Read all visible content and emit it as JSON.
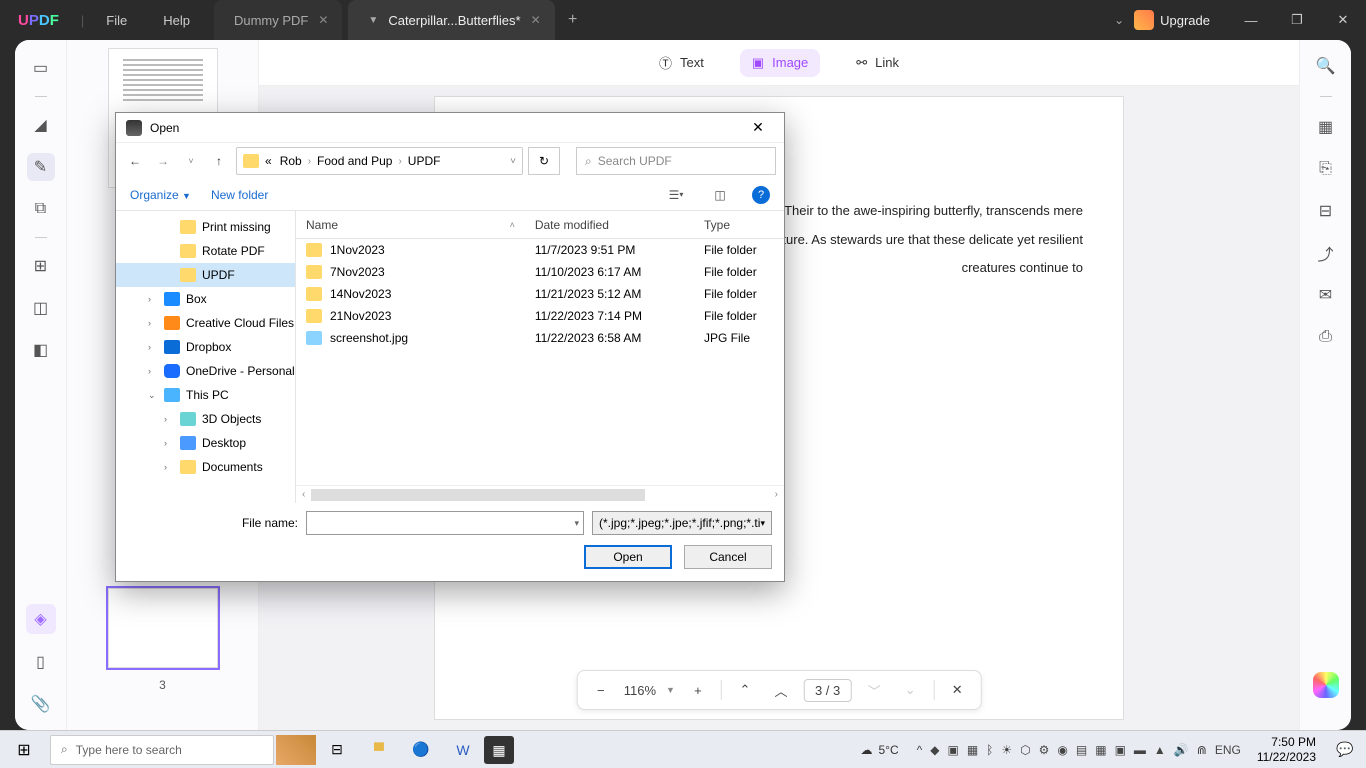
{
  "titlebar": {
    "menu": {
      "file": "File",
      "help": "Help"
    },
    "tabs": [
      {
        "label": "Dummy PDF",
        "active": false
      },
      {
        "label": "Caterpillar...Butterflies*",
        "active": true
      }
    ],
    "upgrade": "Upgrade"
  },
  "tools": {
    "text": "Text",
    "image": "Image",
    "link": "Link"
  },
  "page_text": "essence of transformation, resilience, and beauty. Their to the awe-inspiring butterfly, transcends mere biological hope, adaptability, and the wonders of nature. As stewards ure that these delicate yet resilient creatures continue to",
  "bottombar": {
    "zoom": "116%",
    "page": "3 / 3"
  },
  "thumbnail_label": "3",
  "dialog": {
    "title": "Open",
    "breadcrumbs": [
      "«",
      "Rob",
      "Food and Pup",
      "UPDF"
    ],
    "search_placeholder": "Search UPDF",
    "organize": "Organize",
    "newfolder": "New folder",
    "columns": {
      "name": "Name",
      "date": "Date modified",
      "type": "Type"
    },
    "tree": [
      {
        "label": "Print missing",
        "icon": "fldr",
        "level": 3
      },
      {
        "label": "Rotate PDF",
        "icon": "fldr",
        "level": 3
      },
      {
        "label": "UPDF",
        "icon": "fldr",
        "level": 3,
        "selected": true
      },
      {
        "label": "Box",
        "icon": "box",
        "level": 2,
        "expandable": true
      },
      {
        "label": "Creative Cloud Files",
        "icon": "cc",
        "level": 2,
        "expandable": true
      },
      {
        "label": "Dropbox",
        "icon": "db",
        "level": 2,
        "expandable": true
      },
      {
        "label": "OneDrive - Personal",
        "icon": "od",
        "level": 2,
        "expandable": true
      },
      {
        "label": "This PC",
        "icon": "pc",
        "level": 2,
        "expanded": true
      },
      {
        "label": "3D Objects",
        "icon": "obj",
        "level": 3,
        "expandable": true
      },
      {
        "label": "Desktop",
        "icon": "desk",
        "level": 3,
        "expandable": true
      },
      {
        "label": "Documents",
        "icon": "fldr",
        "level": 3,
        "expandable": true
      }
    ],
    "files": [
      {
        "name": "1Nov2023",
        "date": "11/7/2023 9:51 PM",
        "type": "File folder",
        "icon": "fldr"
      },
      {
        "name": "7Nov2023",
        "date": "11/10/2023 6:17 AM",
        "type": "File folder",
        "icon": "fldr"
      },
      {
        "name": "14Nov2023",
        "date": "11/21/2023 5:12 AM",
        "type": "File folder",
        "icon": "fldr"
      },
      {
        "name": "21Nov2023",
        "date": "11/22/2023 7:14 PM",
        "type": "File folder",
        "icon": "fldr"
      },
      {
        "name": "screenshot.jpg",
        "date": "11/22/2023 6:58 AM",
        "type": "JPG File",
        "icon": "jpg"
      }
    ],
    "filename_label": "File name:",
    "filter": "(*.jpg;*.jpeg;*.jpe;*.jfif;*.png;*.ti",
    "open_btn": "Open",
    "cancel_btn": "Cancel"
  },
  "taskbar": {
    "search_placeholder": "Type here to search",
    "weather": "5°C",
    "lang": "ENG",
    "time": "7:50 PM",
    "date": "11/22/2023"
  }
}
